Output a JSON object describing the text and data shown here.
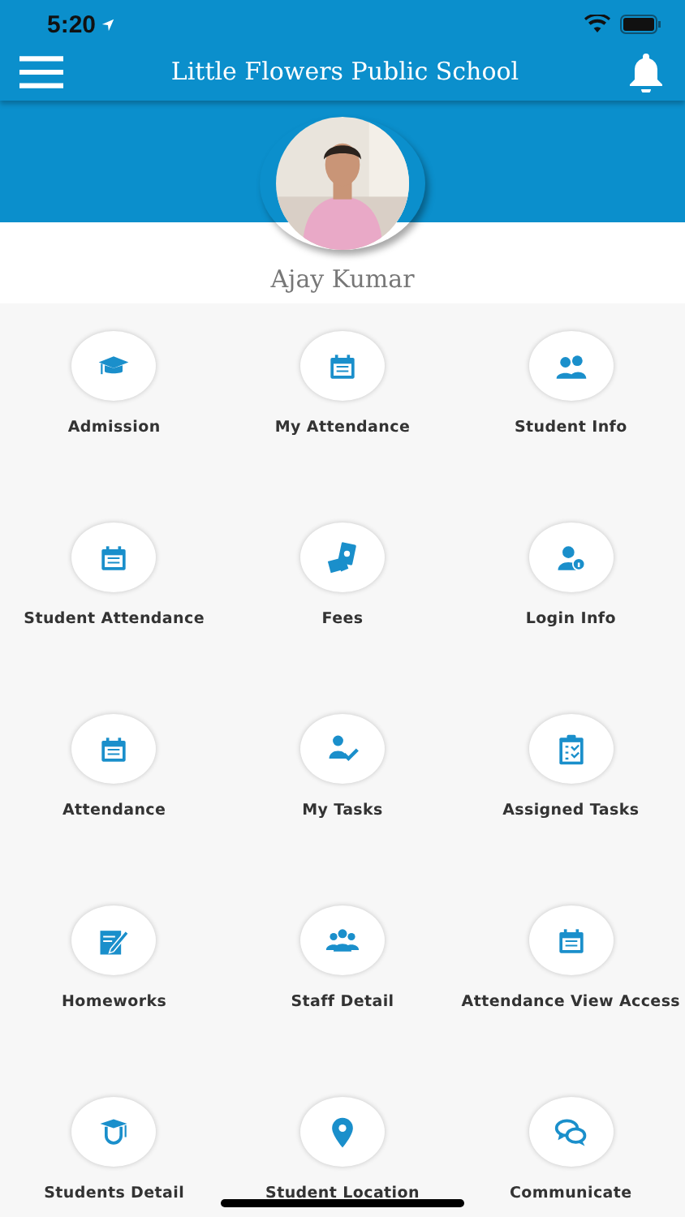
{
  "status_bar": {
    "time": "5:20"
  },
  "header": {
    "title": "Little Flowers Public School"
  },
  "profile": {
    "name": "Ajay Kumar"
  },
  "menu": [
    {
      "label": "Admission"
    },
    {
      "label": "My Attendance"
    },
    {
      "label": "Student Info"
    },
    {
      "label": "Student Attendance"
    },
    {
      "label": "Fees"
    },
    {
      "label": "Login Info"
    },
    {
      "label": "Attendance"
    },
    {
      "label": "My Tasks"
    },
    {
      "label": "Assigned Tasks"
    },
    {
      "label": "Homeworks"
    },
    {
      "label": "Staff Detail"
    },
    {
      "label": "Attendance View Access"
    },
    {
      "label": "Students Detail"
    },
    {
      "label": "Student Location"
    },
    {
      "label": "Communicate"
    }
  ]
}
